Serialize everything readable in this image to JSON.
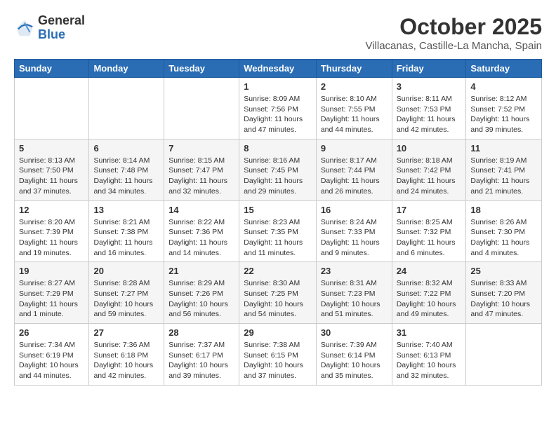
{
  "header": {
    "logo_general": "General",
    "logo_blue": "Blue",
    "month_title": "October 2025",
    "location": "Villacanas, Castille-La Mancha, Spain"
  },
  "weekdays": [
    "Sunday",
    "Monday",
    "Tuesday",
    "Wednesday",
    "Thursday",
    "Friday",
    "Saturday"
  ],
  "weeks": [
    [
      {
        "day": "",
        "info": ""
      },
      {
        "day": "",
        "info": ""
      },
      {
        "day": "",
        "info": ""
      },
      {
        "day": "1",
        "info": "Sunrise: 8:09 AM\nSunset: 7:56 PM\nDaylight: 11 hours and 47 minutes."
      },
      {
        "day": "2",
        "info": "Sunrise: 8:10 AM\nSunset: 7:55 PM\nDaylight: 11 hours and 44 minutes."
      },
      {
        "day": "3",
        "info": "Sunrise: 8:11 AM\nSunset: 7:53 PM\nDaylight: 11 hours and 42 minutes."
      },
      {
        "day": "4",
        "info": "Sunrise: 8:12 AM\nSunset: 7:52 PM\nDaylight: 11 hours and 39 minutes."
      }
    ],
    [
      {
        "day": "5",
        "info": "Sunrise: 8:13 AM\nSunset: 7:50 PM\nDaylight: 11 hours and 37 minutes."
      },
      {
        "day": "6",
        "info": "Sunrise: 8:14 AM\nSunset: 7:48 PM\nDaylight: 11 hours and 34 minutes."
      },
      {
        "day": "7",
        "info": "Sunrise: 8:15 AM\nSunset: 7:47 PM\nDaylight: 11 hours and 32 minutes."
      },
      {
        "day": "8",
        "info": "Sunrise: 8:16 AM\nSunset: 7:45 PM\nDaylight: 11 hours and 29 minutes."
      },
      {
        "day": "9",
        "info": "Sunrise: 8:17 AM\nSunset: 7:44 PM\nDaylight: 11 hours and 26 minutes."
      },
      {
        "day": "10",
        "info": "Sunrise: 8:18 AM\nSunset: 7:42 PM\nDaylight: 11 hours and 24 minutes."
      },
      {
        "day": "11",
        "info": "Sunrise: 8:19 AM\nSunset: 7:41 PM\nDaylight: 11 hours and 21 minutes."
      }
    ],
    [
      {
        "day": "12",
        "info": "Sunrise: 8:20 AM\nSunset: 7:39 PM\nDaylight: 11 hours and 19 minutes."
      },
      {
        "day": "13",
        "info": "Sunrise: 8:21 AM\nSunset: 7:38 PM\nDaylight: 11 hours and 16 minutes."
      },
      {
        "day": "14",
        "info": "Sunrise: 8:22 AM\nSunset: 7:36 PM\nDaylight: 11 hours and 14 minutes."
      },
      {
        "day": "15",
        "info": "Sunrise: 8:23 AM\nSunset: 7:35 PM\nDaylight: 11 hours and 11 minutes."
      },
      {
        "day": "16",
        "info": "Sunrise: 8:24 AM\nSunset: 7:33 PM\nDaylight: 11 hours and 9 minutes."
      },
      {
        "day": "17",
        "info": "Sunrise: 8:25 AM\nSunset: 7:32 PM\nDaylight: 11 hours and 6 minutes."
      },
      {
        "day": "18",
        "info": "Sunrise: 8:26 AM\nSunset: 7:30 PM\nDaylight: 11 hours and 4 minutes."
      }
    ],
    [
      {
        "day": "19",
        "info": "Sunrise: 8:27 AM\nSunset: 7:29 PM\nDaylight: 11 hours and 1 minute."
      },
      {
        "day": "20",
        "info": "Sunrise: 8:28 AM\nSunset: 7:27 PM\nDaylight: 10 hours and 59 minutes."
      },
      {
        "day": "21",
        "info": "Sunrise: 8:29 AM\nSunset: 7:26 PM\nDaylight: 10 hours and 56 minutes."
      },
      {
        "day": "22",
        "info": "Sunrise: 8:30 AM\nSunset: 7:25 PM\nDaylight: 10 hours and 54 minutes."
      },
      {
        "day": "23",
        "info": "Sunrise: 8:31 AM\nSunset: 7:23 PM\nDaylight: 10 hours and 51 minutes."
      },
      {
        "day": "24",
        "info": "Sunrise: 8:32 AM\nSunset: 7:22 PM\nDaylight: 10 hours and 49 minutes."
      },
      {
        "day": "25",
        "info": "Sunrise: 8:33 AM\nSunset: 7:20 PM\nDaylight: 10 hours and 47 minutes."
      }
    ],
    [
      {
        "day": "26",
        "info": "Sunrise: 7:34 AM\nSunset: 6:19 PM\nDaylight: 10 hours and 44 minutes."
      },
      {
        "day": "27",
        "info": "Sunrise: 7:36 AM\nSunset: 6:18 PM\nDaylight: 10 hours and 42 minutes."
      },
      {
        "day": "28",
        "info": "Sunrise: 7:37 AM\nSunset: 6:17 PM\nDaylight: 10 hours and 39 minutes."
      },
      {
        "day": "29",
        "info": "Sunrise: 7:38 AM\nSunset: 6:15 PM\nDaylight: 10 hours and 37 minutes."
      },
      {
        "day": "30",
        "info": "Sunrise: 7:39 AM\nSunset: 6:14 PM\nDaylight: 10 hours and 35 minutes."
      },
      {
        "day": "31",
        "info": "Sunrise: 7:40 AM\nSunset: 6:13 PM\nDaylight: 10 hours and 32 minutes."
      },
      {
        "day": "",
        "info": ""
      }
    ]
  ]
}
